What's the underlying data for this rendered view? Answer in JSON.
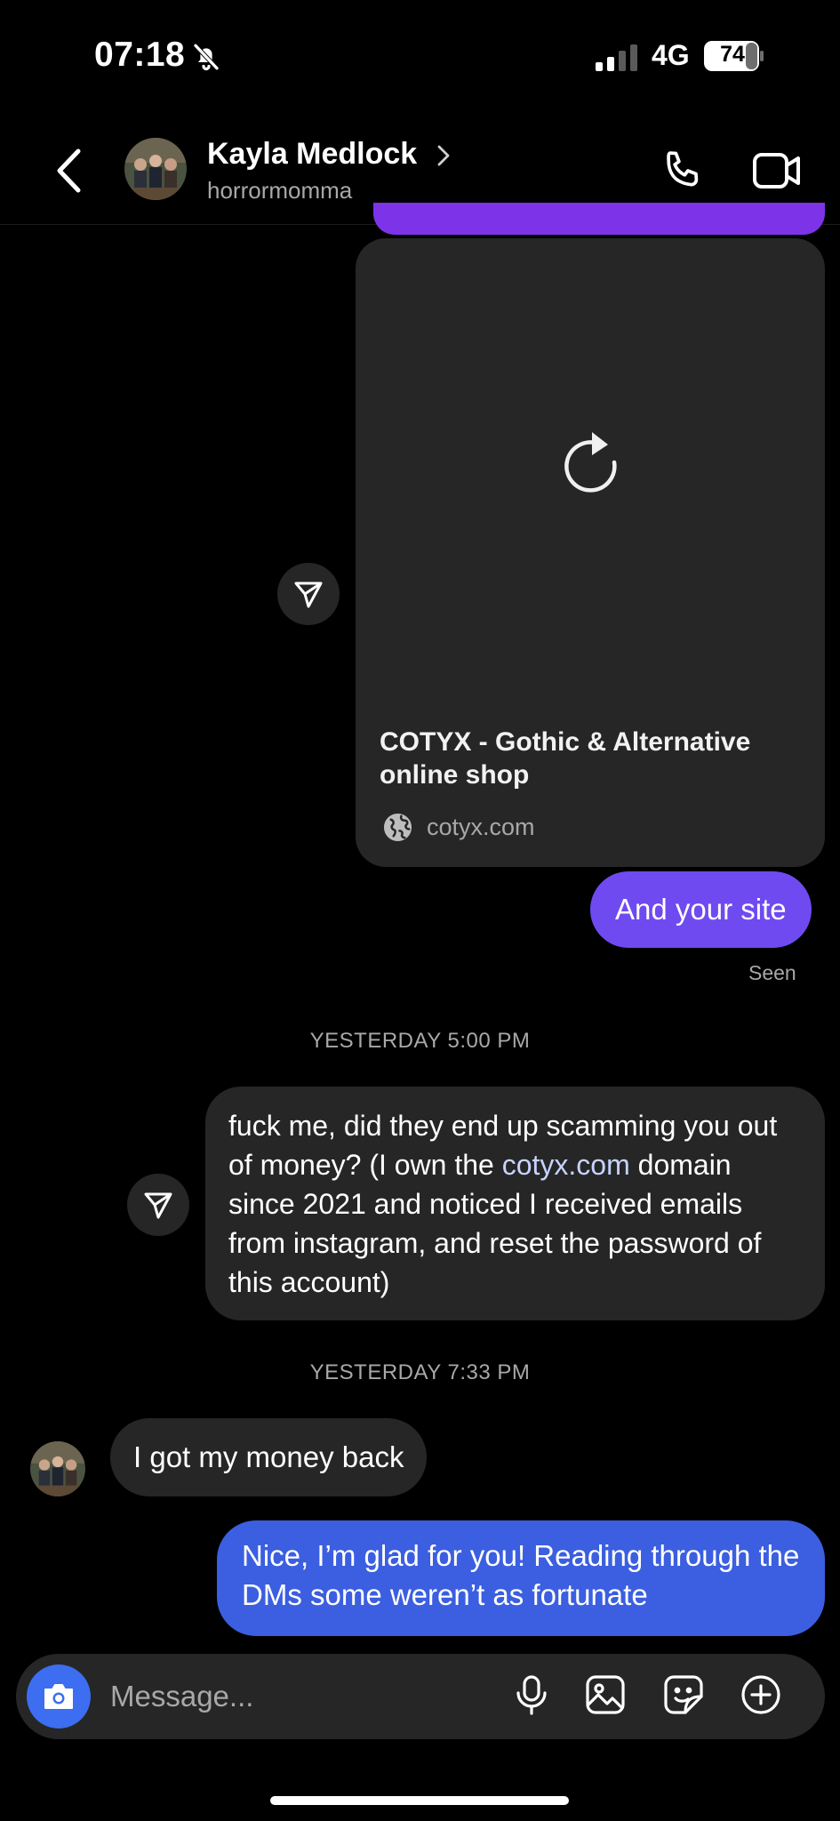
{
  "status_bar": {
    "time": "07:18",
    "network": "4G",
    "battery": "74"
  },
  "header": {
    "name": "Kayla Medlock",
    "username": "horrormomma"
  },
  "messages": {
    "link_card": {
      "title": "COTYX - Gothic & Alternative online shop",
      "domain": "cotyx.com"
    },
    "sent_1": "And your site",
    "seen": "Seen",
    "timestamp_1": "YESTERDAY 5:00 PM",
    "received_long": {
      "part1": "fuck me, did they end up scamming you out of money? (I own the ",
      "link": "cotyx.com",
      "part2": " domain since 2021 and noticed I received emails from instagram, and reset the password of this account)"
    },
    "timestamp_2": "YESTERDAY 7:33 PM",
    "received_short": "I got my money back",
    "sent_2": "Nice, I’m glad for you! Reading through the DMs some weren’t as fortunate"
  },
  "composer": {
    "placeholder": "Message..."
  },
  "colors": {
    "background": "#000000",
    "bubble_grey": "#262626",
    "bubble_purple": "#6f4af0",
    "bubble_blue": "#3b5fe0",
    "camera_button": "#3d6df0"
  },
  "icons": [
    "bell-slash-icon",
    "signal-icon",
    "battery-icon",
    "back-chevron-icon",
    "chevron-right-icon",
    "phone-icon",
    "video-icon",
    "reload-icon",
    "globe-icon",
    "share-icon",
    "camera-icon",
    "microphone-icon",
    "gallery-icon",
    "sticker-icon",
    "plus-icon"
  ]
}
